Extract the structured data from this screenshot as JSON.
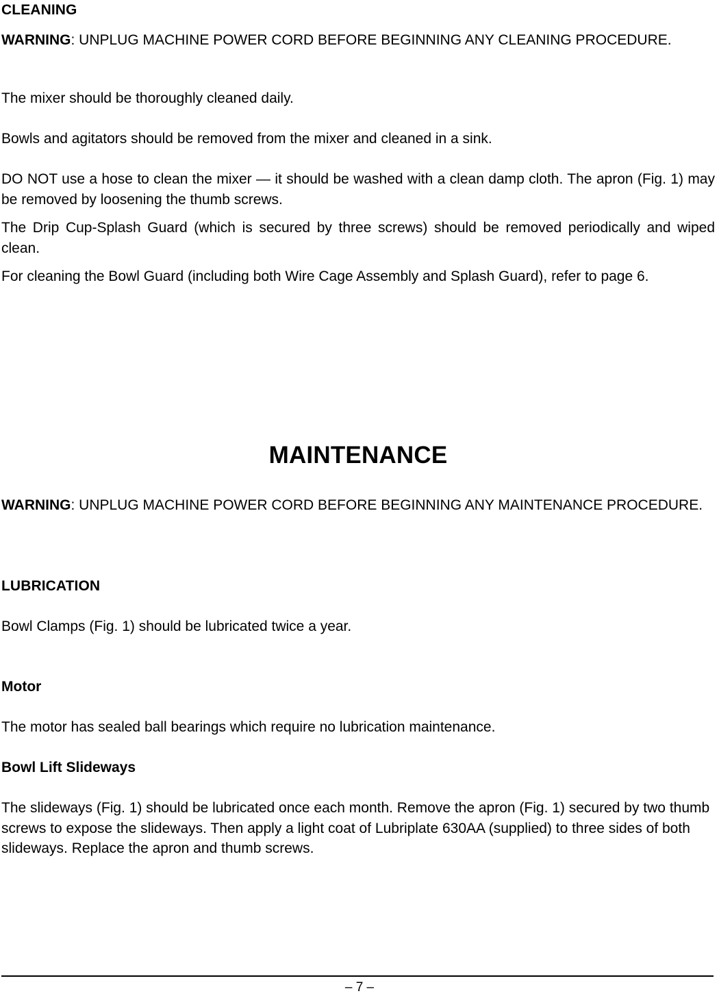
{
  "document": {
    "type": "equipment-manual-page",
    "page_label": "– 7 –"
  },
  "cleaning": {
    "heading": "CLEANING",
    "warning_label": "WARNING",
    "warning_text": ":  UNPLUG MACHINE POWER CORD BEFORE BEGINNING ANY CLEANING PROCEDURE.",
    "paragraphs": [
      "The mixer should be thoroughly cleaned daily.",
      "Bowls and agitators should be removed from the mixer and cleaned in a sink.",
      "DO NOT use a hose to clean the mixer — it should be washed with a clean damp cloth.  The apron (Fig. 1) may be removed by loosening the thumb screws.",
      "The Drip Cup-Splash Guard (which is secured by three screws) should be removed periodically and wiped clean.",
      "For cleaning the Bowl Guard (including both Wire Cage Assembly and Splash Guard), refer to page 6."
    ]
  },
  "maintenance": {
    "title": "MAINTENANCE",
    "warning_label": "WARNING",
    "warning_text": ":  UNPLUG MACHINE POWER CORD BEFORE BEGINNING ANY MAINTENANCE PROCEDURE.",
    "lubrication": {
      "heading": "LUBRICATION",
      "paragraph": "Bowl Clamps (Fig. 1) should be lubricated twice a year."
    },
    "motor": {
      "heading": "Motor",
      "paragraph": "The motor has sealed ball bearings which require no lubrication maintenance."
    },
    "bowl_lift_slideways": {
      "heading": "Bowl Lift Slideways",
      "paragraph": "The slideways (Fig. 1) should be lubricated once each month.  Remove the apron (Fig. 1) secured by two thumb screws to expose the slideways.  Then apply a light coat of Lubriplate 630AA (supplied) to three sides of both slideways.  Replace the apron and thumb screws."
    }
  },
  "footer": {
    "page_number": "– 7 –"
  },
  "colors": {
    "text": "#000000",
    "background": "#ffffff",
    "rule": "#000000"
  }
}
